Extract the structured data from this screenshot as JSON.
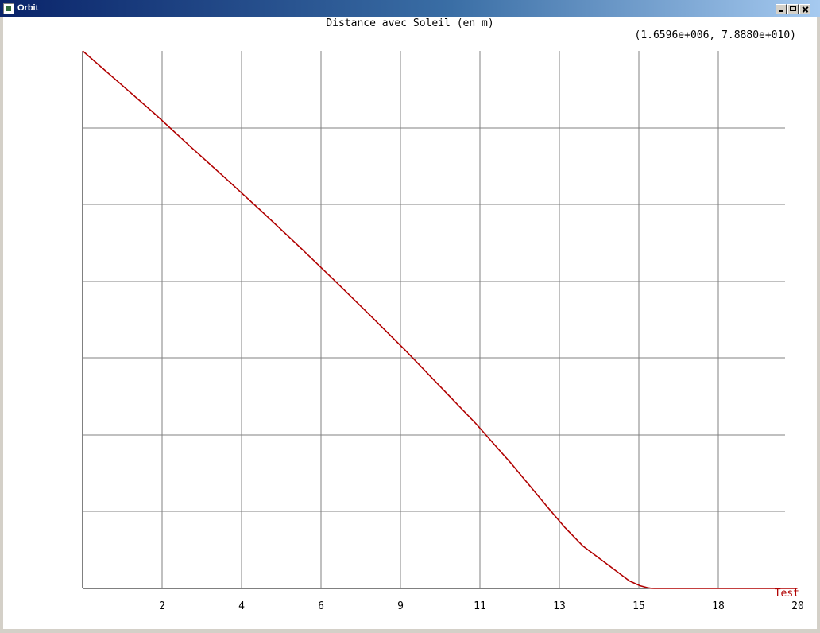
{
  "window": {
    "title": "Orbit"
  },
  "chart_data": {
    "type": "line",
    "title": "Distance avec Soleil (en m)",
    "coordinate_readout": "(1.6596e+006, 7.8880e+010)",
    "x_tick_labels": [
      "2",
      "4",
      "6",
      "9",
      "11",
      "13",
      "15",
      "18",
      "20"
    ],
    "xlim": [
      0,
      20
    ],
    "ylim": [
      0,
      100
    ],
    "grid": true,
    "y_tick_labels_shown": false,
    "legend_position": "bottom-right",
    "colors": {
      "series": "#b00000",
      "grid": "#808080",
      "axis": "#000000"
    },
    "series": [
      {
        "name": "Test",
        "x": [
          0.0,
          1.0,
          2.0,
          3.0,
          4.0,
          5.0,
          6.0,
          7.0,
          8.0,
          9.0,
          10.0,
          11.0,
          12.0,
          13.0,
          13.5,
          14.0,
          14.5,
          15.0,
          15.3,
          15.6,
          15.8,
          15.9,
          16.0,
          16.7,
          17.5,
          18.5,
          19.5,
          20.0
        ],
        "y": [
          100.0,
          94.2,
          88.4,
          82.3,
          76.3,
          70.2,
          64.0,
          57.6,
          51.1,
          44.5,
          37.6,
          30.7,
          23.2,
          15.2,
          11.3,
          7.9,
          5.4,
          2.9,
          1.4,
          0.5,
          0.15,
          0.03,
          0.0,
          0.0,
          0.0,
          0.0,
          0.0,
          0.0
        ]
      }
    ]
  }
}
